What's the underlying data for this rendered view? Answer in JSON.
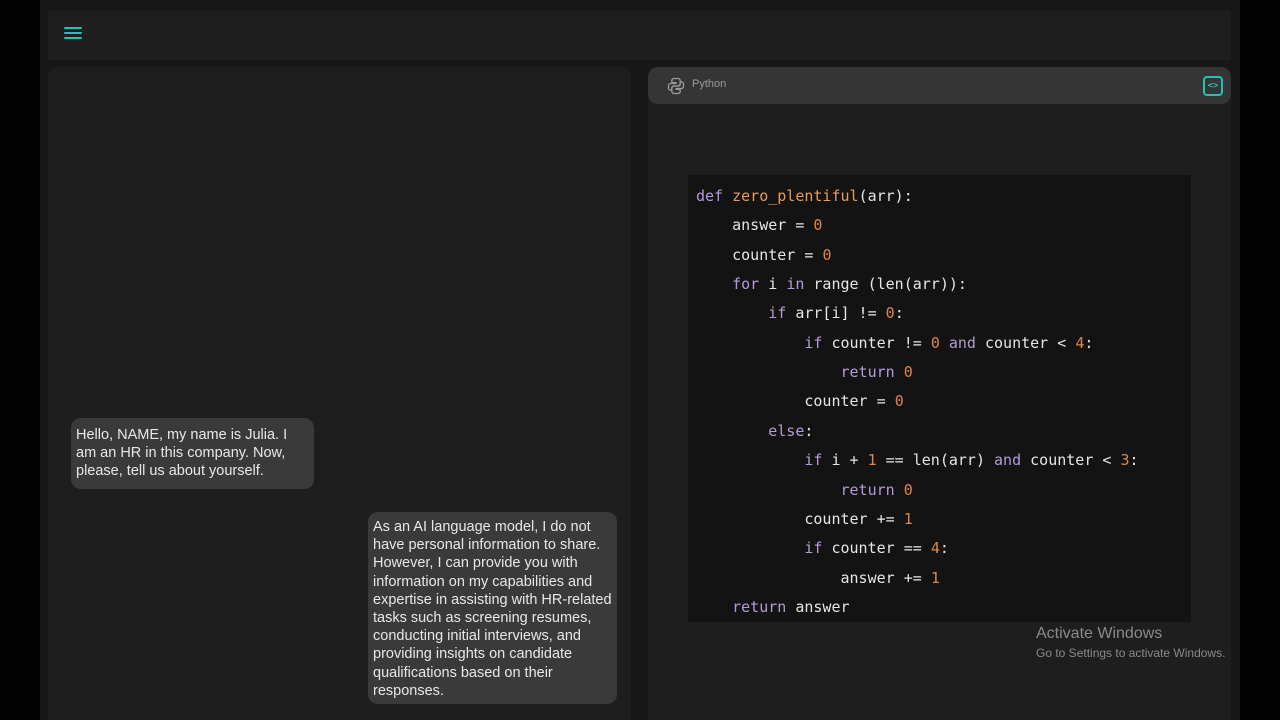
{
  "topbar": {
    "menu_icon": "hamburger-menu-icon"
  },
  "chat": {
    "messages": [
      {
        "role": "hr",
        "text": "Hello, NAME, my name is Julia. I am an HR in this company. Now, please, tell us about yourself."
      },
      {
        "role": "ai",
        "text": "As an AI language model, I do not have personal information to share. However, I can provide you with information on my capabilities and expertise in assisting with HR-related tasks such as screening resumes, conducting initial interviews, and providing insights on candidate qualifications based on their responses."
      }
    ]
  },
  "code_panel": {
    "language": "Python",
    "language_icon": "python-icon",
    "toggle_icon": "code-brackets-icon",
    "lines": [
      "def zero_plentiful(arr):",
      "    answer = 0",
      "    counter = 0",
      "    for i in range (len(arr)):",
      "        if arr[i] != 0:",
      "            if counter != 0 and counter < 4:",
      "                return 0",
      "            counter = 0",
      "        else:",
      "            if i + 1 == len(arr) and counter < 3:",
      "                return 0",
      "            counter += 1",
      "            if counter == 4:",
      "                answer += 1",
      "    return answer"
    ]
  },
  "watermark": {
    "title": "Activate Windows",
    "subtitle": "Go to Settings to activate Windows."
  },
  "colors": {
    "accent": "#22c3b3",
    "keyword": "#b49bd6",
    "function": "#e89b5c",
    "number": "#e0864a",
    "bubble_bg": "#3a3a3a"
  }
}
